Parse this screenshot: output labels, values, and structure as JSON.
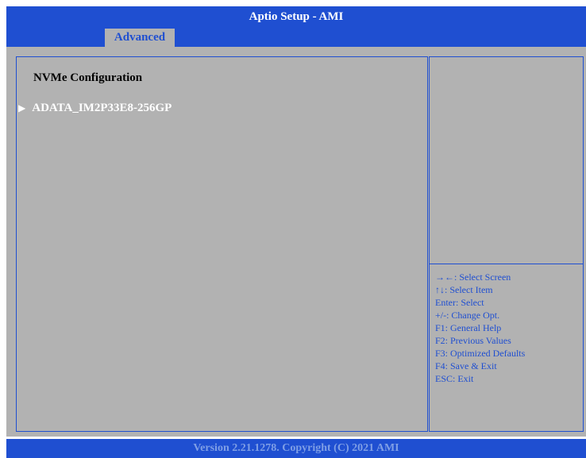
{
  "header": {
    "title": "Aptio Setup  - AMI"
  },
  "tabs": [
    {
      "label": "Advanced",
      "active": true
    }
  ],
  "main": {
    "panel_title": "NVMe Configuration",
    "items": [
      {
        "icon": "triangle-right-icon",
        "label": "ADATA_IM2P33E8-256GP"
      }
    ]
  },
  "help": {
    "keys": [
      "→←: Select Screen",
      "↑↓: Select Item",
      "Enter: Select",
      "+/-: Change Opt.",
      "F1: General Help",
      "F2: Previous Values",
      "F3: Optimized Defaults",
      "F4: Save & Exit",
      "ESC: Exit"
    ]
  },
  "footer": {
    "text": "Version 2.21.1278. Copyright (C) 2021 AMI"
  },
  "colors": {
    "primary_blue": "#1f4fd1",
    "panel_gray": "#b2b2b2",
    "footer_text": "#7f9fe6"
  }
}
